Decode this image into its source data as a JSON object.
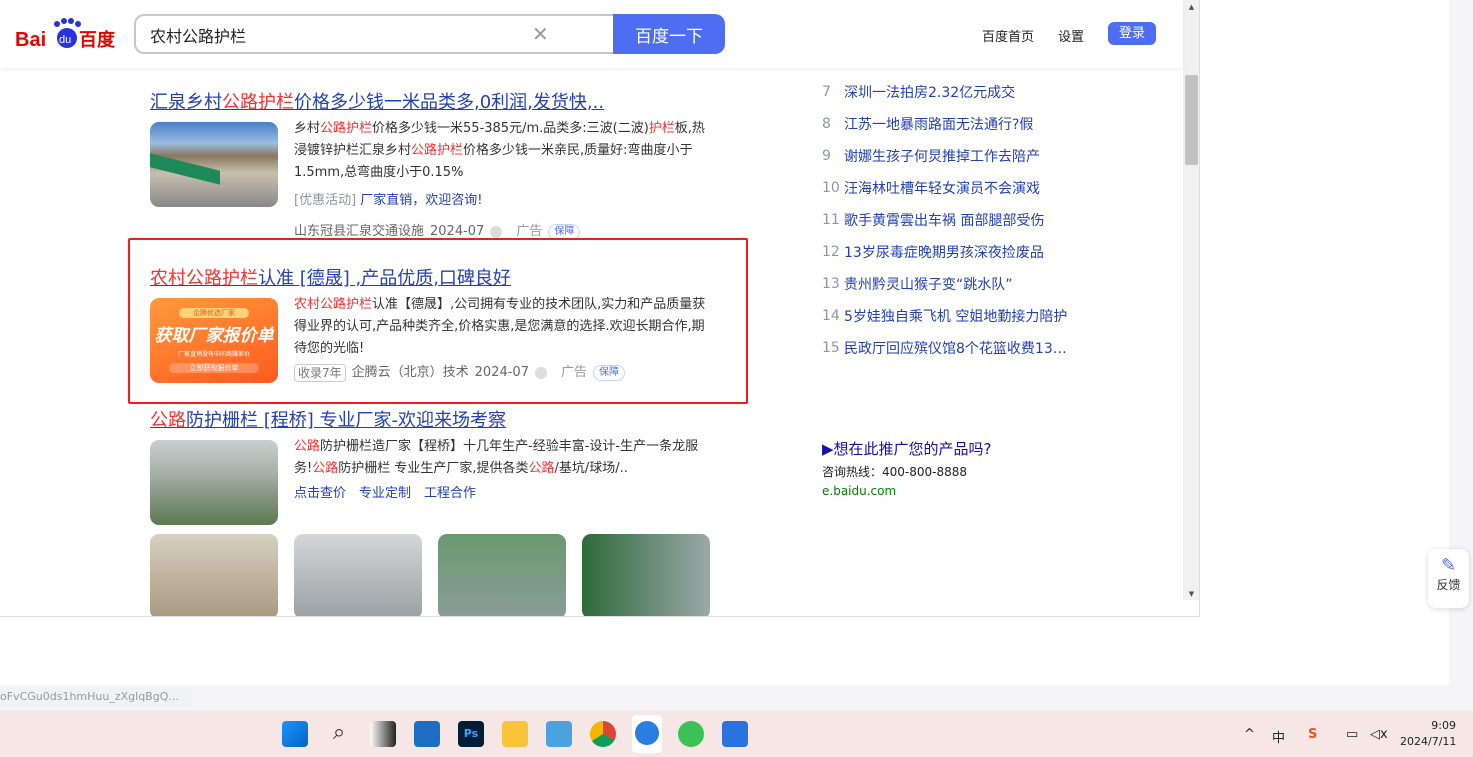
{
  "header": {
    "logo": "Bai百度",
    "search_value": "农村公路护栏",
    "search_button": "百度一下",
    "home_link": "百度首页",
    "settings_link": "设置",
    "login_button": "登录"
  },
  "results": [
    {
      "title": [
        "汇泉乡村",
        "公路护栏",
        "价格多少钱一米品类多,0利润,发货快,.."
      ],
      "desc": [
        "乡村",
        "公路护栏",
        "价格多少钱一米55-385元/m.品类多:三波(二波)",
        "护栏",
        "板,热浸镀锌护栏汇泉乡村",
        "公路护栏",
        "价格多少钱一米亲民,质量好:弯曲度小于1.5mm,总弯曲度小于0.15%"
      ],
      "promo_tag": "[优惠活动]",
      "promo_text": "厂家直销，欢迎咨询!",
      "source": "山东冠县汇泉交通设施",
      "date": "2024-07",
      "ad": "广告",
      "badge": "保障"
    },
    {
      "title": [
        "农村公路护栏",
        "认准 [德晟] ,产品优质,口碑良好"
      ],
      "desc": [
        "农村公路护栏",
        "认准【德晟】,公司拥有专业的技术团队,实力和产品质量获得业界的认可,产品种类齐全,价格实惠,是您满意的选择.欢迎长期合作,期待您的光临!"
      ],
      "thumb_text": {
        "top": "企腾优选厂家",
        "main": "获取厂家报价单",
        "sub": "厂家直销没有中间商赚差价",
        "btn": "立即获取报价单"
      },
      "tag": "收录7年",
      "source": "企腾云（北京）技术",
      "date": "2024-07",
      "ad": "广告",
      "badge": "保障"
    },
    {
      "title": [
        "公路",
        "防护栅栏 [程桥] 专业厂家-欢迎来场考察"
      ],
      "desc": [
        "公路",
        "防护栅栏造厂家【程桥】十几年生产-经验丰富-设计-生产一条龙服务!",
        "公路",
        "防护栅栏 专业生产厂家,提供各类",
        "公路",
        "/基坑/球场/.."
      ],
      "links": [
        "点击查价",
        "专业定制",
        "工程合作"
      ]
    }
  ],
  "hot_list": [
    {
      "rank": "7",
      "title": "深圳一法拍房2.32亿元成交"
    },
    {
      "rank": "8",
      "title": "江苏一地暴雨路面无法通行?假"
    },
    {
      "rank": "9",
      "title": "谢娜生孩子何炅推掉工作去陪产"
    },
    {
      "rank": "10",
      "title": "汪海林吐槽年轻女演员不会演戏"
    },
    {
      "rank": "11",
      "title": "歌手黄霄雲出车祸 面部腿部受伤"
    },
    {
      "rank": "12",
      "title": "13岁尿毒症晚期男孩深夜捡废品"
    },
    {
      "rank": "13",
      "title": "贵州黔灵山猴子变“跳水队”"
    },
    {
      "rank": "14",
      "title": "5岁娃独自乘飞机 空姐地勤接力陪护"
    },
    {
      "rank": "15",
      "title": "民政厅回应殡仪馆8个花篮收费138…"
    }
  ],
  "promo": {
    "title": "▶想在此推广您的产品吗?",
    "hotline": "咨询热线：400-800-8888",
    "site": "e.baidu.com"
  },
  "feedback": "反馈",
  "status_url": "oFvCGu0ds1hmHuu_zXglqBgQ...",
  "taskbar": {
    "time": "9:09",
    "date": "2024/7/11",
    "ime": "中"
  },
  "colors": {
    "accent": "#4e6ef2",
    "highlight": "#f73131",
    "link": "#2440b3",
    "box": "#f01d1d"
  }
}
